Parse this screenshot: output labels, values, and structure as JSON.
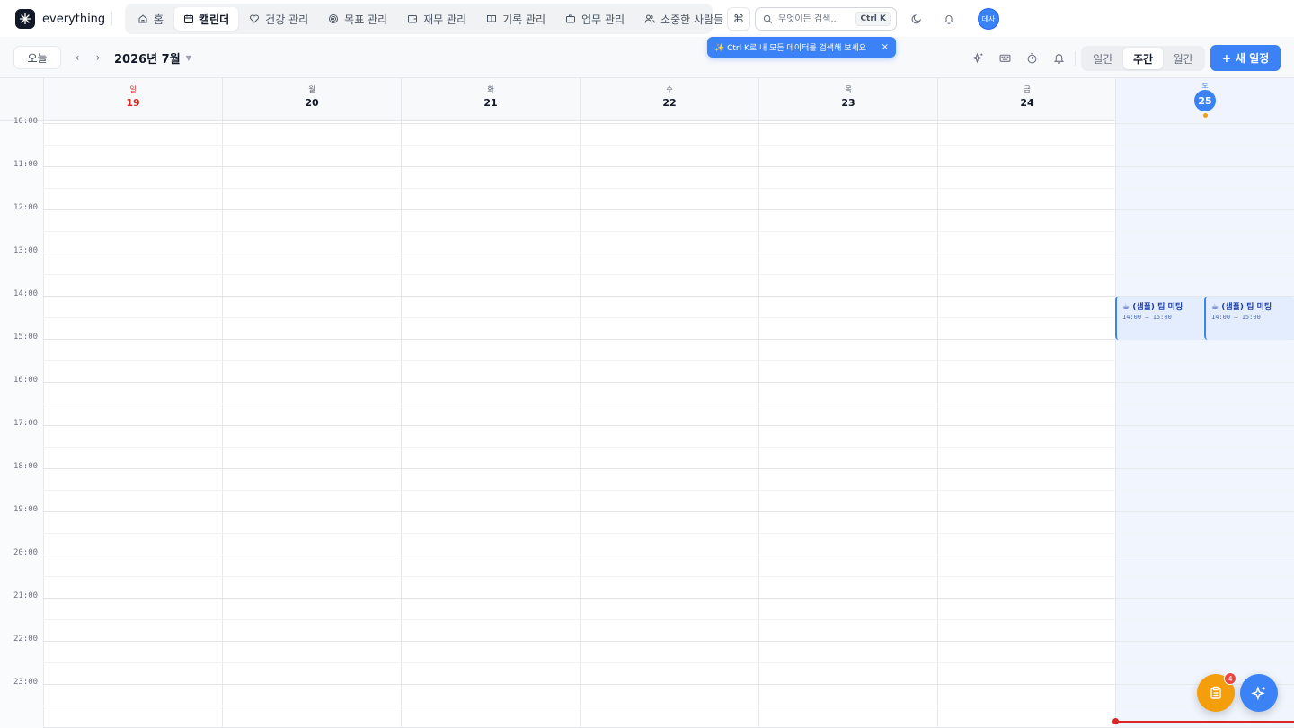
{
  "brand": {
    "name": "everything"
  },
  "nav": {
    "items": [
      {
        "label": "홈",
        "icon": "home-icon",
        "active": false
      },
      {
        "label": "캘린더",
        "icon": "calendar-icon",
        "active": true
      },
      {
        "label": "건강 관리",
        "icon": "heart-icon",
        "active": false
      },
      {
        "label": "목표 관리",
        "icon": "target-icon",
        "active": false
      },
      {
        "label": "재무 관리",
        "icon": "wallet-icon",
        "active": false
      },
      {
        "label": "기록 관리",
        "icon": "book-icon",
        "active": false
      },
      {
        "label": "업무 관리",
        "icon": "briefcase-icon",
        "active": false
      },
      {
        "label": "소중한 사람들",
        "icon": "users-icon",
        "active": false
      }
    ]
  },
  "header": {
    "command_symbol": "⌘",
    "search_placeholder": "무엇이든 검색...",
    "search_shortcut": "Ctrl K",
    "avatar_text": "데사"
  },
  "tip": {
    "text": "✨ Ctrl K로 내 모든 데이터를 검색해 보세요",
    "close": "×"
  },
  "toolbar": {
    "today_label": "오늘",
    "prev": "‹",
    "next": "›",
    "month_label": "2026년 7월",
    "views": [
      {
        "label": "일간",
        "active": false
      },
      {
        "label": "주간",
        "active": true
      },
      {
        "label": "월간",
        "active": false
      }
    ],
    "new_label": "새 일정",
    "new_icon": "plus-icon"
  },
  "days": [
    {
      "dow": "일",
      "date": "19",
      "type": "sunday"
    },
    {
      "dow": "월",
      "date": "20",
      "type": "normal"
    },
    {
      "dow": "화",
      "date": "21",
      "type": "normal"
    },
    {
      "dow": "수",
      "date": "22",
      "type": "normal"
    },
    {
      "dow": "목",
      "date": "23",
      "type": "normal"
    },
    {
      "dow": "금",
      "date": "24",
      "type": "normal"
    },
    {
      "dow": "토",
      "date": "25",
      "type": "today"
    }
  ],
  "hours": [
    "10:00",
    "11:00",
    "12:00",
    "13:00",
    "14:00",
    "15:00",
    "16:00",
    "17:00",
    "18:00",
    "19:00",
    "20:00",
    "21:00",
    "22:00",
    "23:00"
  ],
  "events": [
    {
      "title": "☕ (샘플) 팀 미팅",
      "time": "14:00 – 15:00"
    },
    {
      "title": "☕ (샘플) 팀 미팅",
      "time": "14:00 – 15:00"
    }
  ],
  "fab": {
    "tasks_badge": "4"
  },
  "colors": {
    "accent": "#3b82f6",
    "sunday": "#dc2626",
    "now_line": "#dc2626",
    "fab_tasks": "#f59e0b"
  }
}
